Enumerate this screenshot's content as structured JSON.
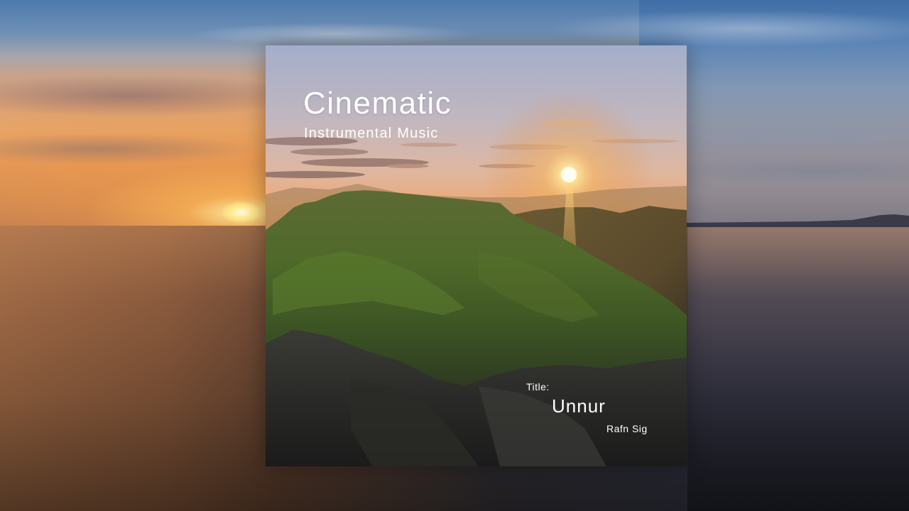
{
  "cover": {
    "title": "Cinematic",
    "subtitle": "Instrumental Music"
  },
  "track": {
    "label": "Title:",
    "name": "Unnur",
    "artist": "Rafn Sig"
  },
  "colors": {
    "sky_top": "#9aa8c4",
    "sunset_orange": "#e8a060",
    "sun": "#fff6d0",
    "mountain_green": "#3f5a26",
    "text": "#ffffff"
  }
}
